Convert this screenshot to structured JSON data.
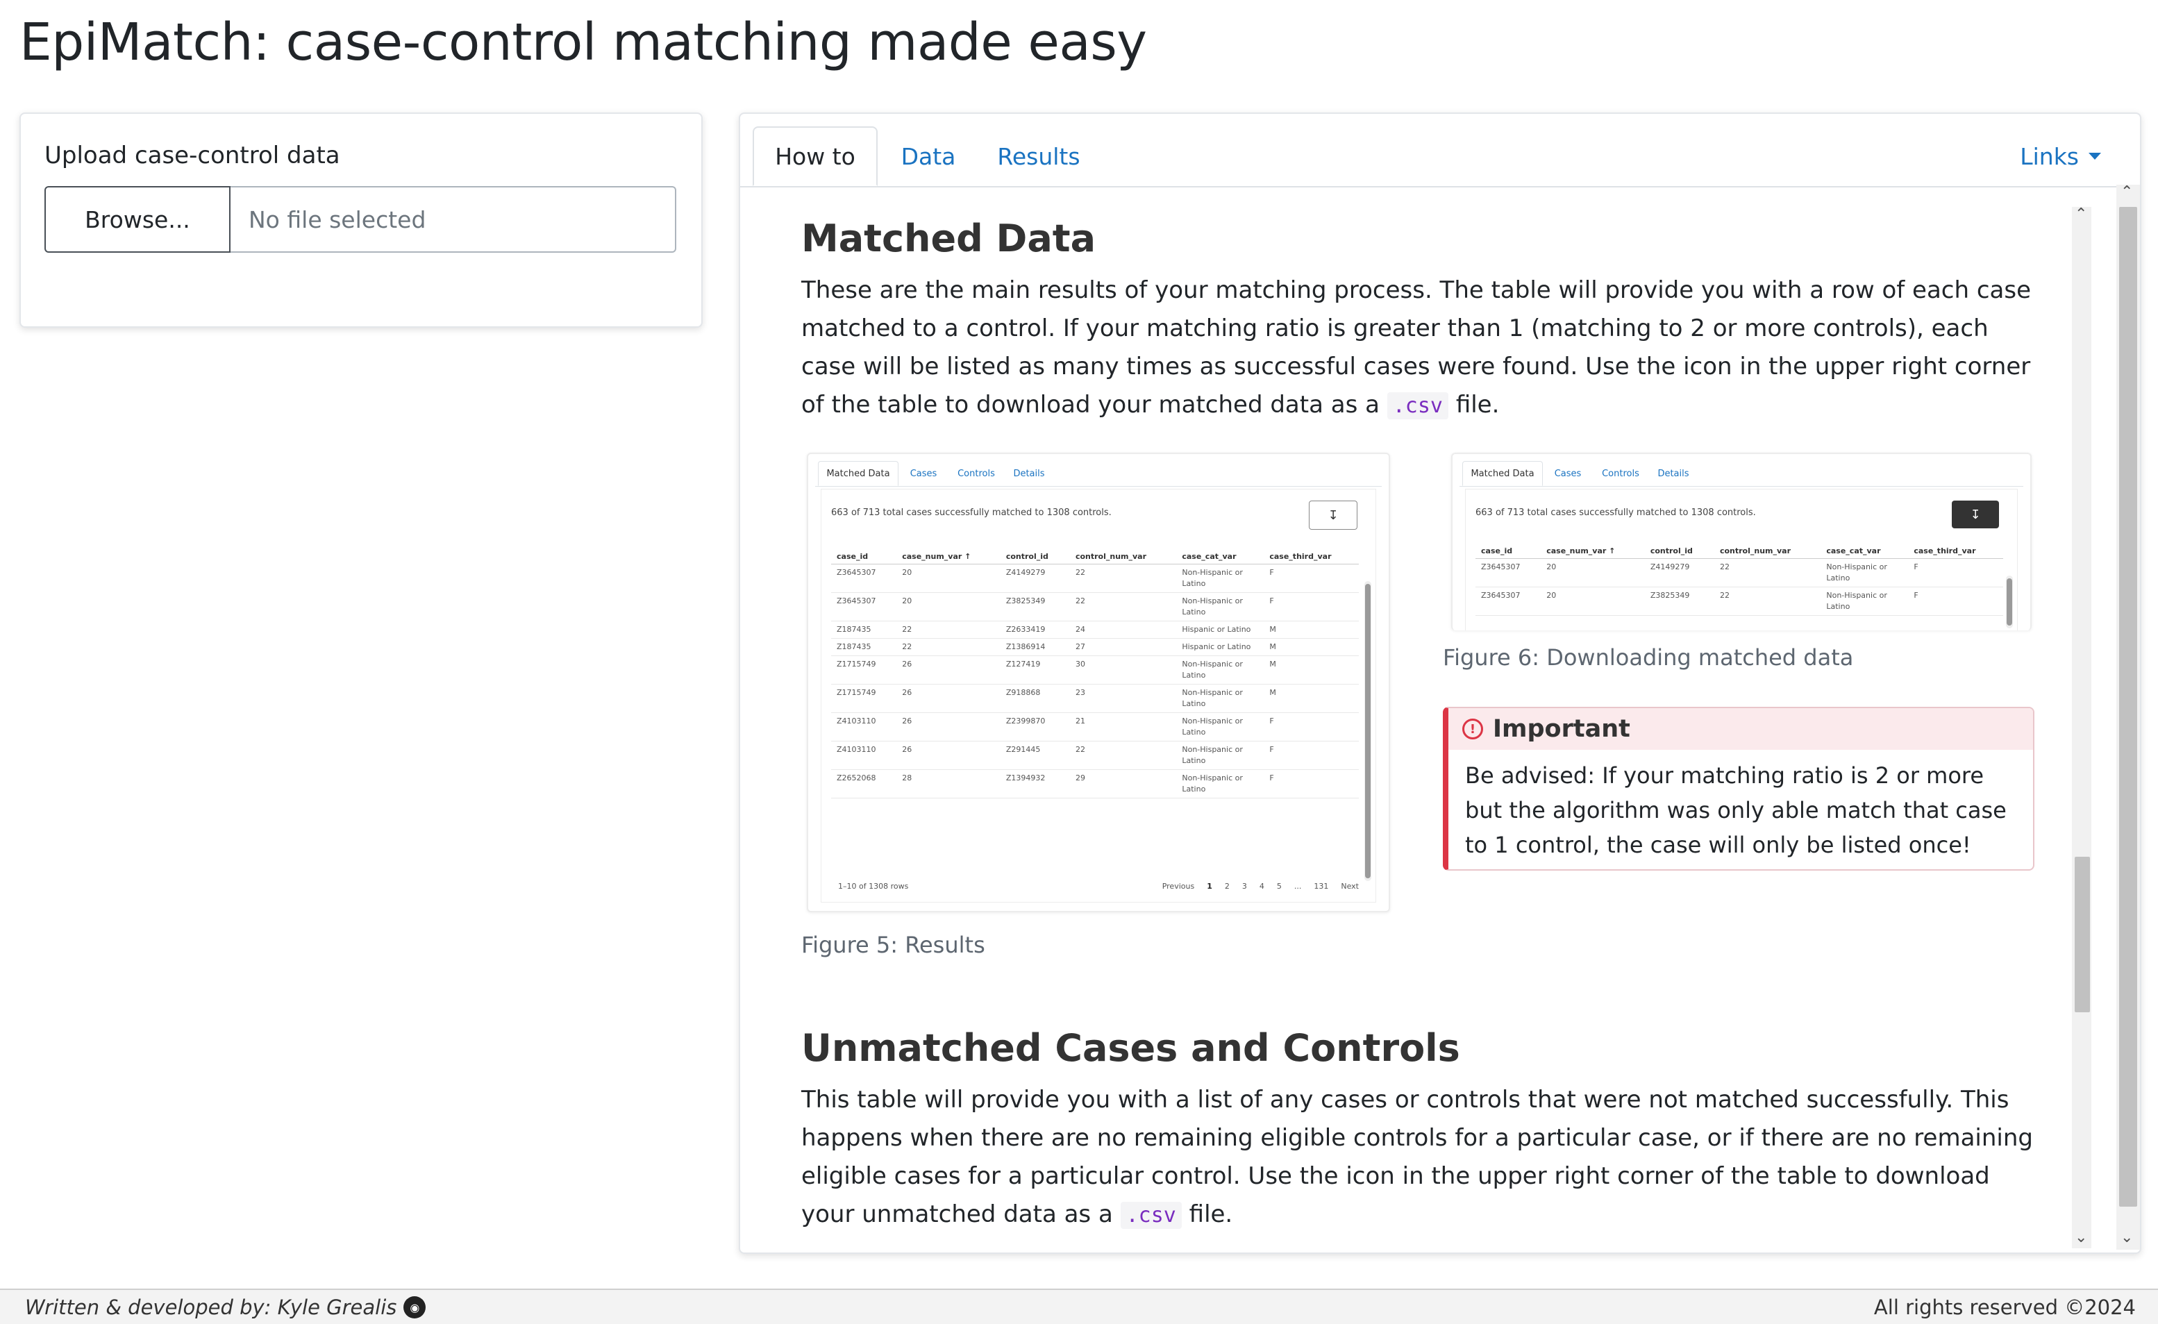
{
  "app": {
    "title": "EpiMatch: case-control matching made easy"
  },
  "sidebar": {
    "upload_label": "Upload case-control data",
    "browse_label": "Browse...",
    "file_placeholder": "No file selected"
  },
  "tabs": {
    "how_to": "How to",
    "data": "Data",
    "results": "Results",
    "links": "Links"
  },
  "matched": {
    "heading": "Matched Data",
    "para_before_code": "These are the main results of your matching process. The table will provide you with a row of each case matched to a control. If your matching ratio is greater than 1 (matching to 2 or more controls), each case will be listed as many times as successful cases were found. Use the icon in the upper right corner of the table to download your matched data as a",
    "code": ".csv",
    "para_after_code": "file."
  },
  "figure5": {
    "tabs": [
      "Matched Data",
      "Cases",
      "Controls",
      "Details"
    ],
    "summary": "663 of 713 total cases successfully matched to 1308 controls.",
    "columns": [
      "case_id",
      "case_num_var ↑",
      "control_id",
      "control_num_var",
      "case_cat_var",
      "case_third_var"
    ],
    "rows": [
      [
        "Z3645307",
        "20",
        "Z4149279",
        "22",
        "Non-Hispanic or Latino",
        "F"
      ],
      [
        "Z3645307",
        "20",
        "Z3825349",
        "22",
        "Non-Hispanic or Latino",
        "F"
      ],
      [
        "Z187435",
        "22",
        "Z2633419",
        "24",
        "Hispanic or Latino",
        "M"
      ],
      [
        "Z187435",
        "22",
        "Z1386914",
        "27",
        "Hispanic or Latino",
        "M"
      ],
      [
        "Z1715749",
        "26",
        "Z127419",
        "30",
        "Non-Hispanic or Latino",
        "M"
      ],
      [
        "Z1715749",
        "26",
        "Z918868",
        "23",
        "Non-Hispanic or Latino",
        "M"
      ],
      [
        "Z4103110",
        "26",
        "Z2399870",
        "21",
        "Non-Hispanic or Latino",
        "F"
      ],
      [
        "Z4103110",
        "26",
        "Z291445",
        "22",
        "Non-Hispanic or Latino",
        "F"
      ],
      [
        "Z2652068",
        "28",
        "Z1394932",
        "29",
        "Non-Hispanic or Latino",
        "F"
      ]
    ],
    "row_count": "1–10 of 1308 rows",
    "pager": [
      "Previous",
      "1",
      "2",
      "3",
      "4",
      "5",
      "...",
      "131",
      "Next"
    ],
    "caption": "Figure 5: Results"
  },
  "figure6": {
    "tabs": [
      "Matched Data",
      "Cases",
      "Controls",
      "Details"
    ],
    "summary": "663 of 713 total cases successfully matched to 1308 controls.",
    "columns": [
      "case_id",
      "case_num_var ↑",
      "control_id",
      "control_num_var",
      "case_cat_var",
      "case_third_var"
    ],
    "rows": [
      [
        "Z3645307",
        "20",
        "Z4149279",
        "22",
        "Non-Hispanic or Latino",
        "F"
      ],
      [
        "Z3645307",
        "20",
        "Z3825349",
        "22",
        "Non-Hispanic or Latino",
        "F"
      ]
    ],
    "caption": "Figure 6: Downloading matched data"
  },
  "important": {
    "title": "Important",
    "body": "Be advised: If your matching ratio is 2 or more but the algorithm was only able match that case to 1 control, the case will only be listed once!"
  },
  "unmatched": {
    "heading": "Unmatched Cases and Controls",
    "para_before_code": "This table will provide you with a list of any cases or controls that were not matched successfully. This happens when there are no remaining eligible controls for a particular case, or if there are no remaining eligible cases for a particular control. Use the icon in the upper right corner of the table to download your unmatched data as a",
    "code": ".csv",
    "para_after_code": "file."
  },
  "footer": {
    "left": "Written & developed by: Kyle Grealis",
    "right": "All rights reserved ©2024"
  },
  "icons": {
    "github": "github-icon",
    "download": "download-icon",
    "warning": "exclamation-circle-icon",
    "caret": "caret-down-icon"
  },
  "colors": {
    "link": "#1a73c1",
    "danger": "#dc3545",
    "code": "#7a2dbf"
  }
}
